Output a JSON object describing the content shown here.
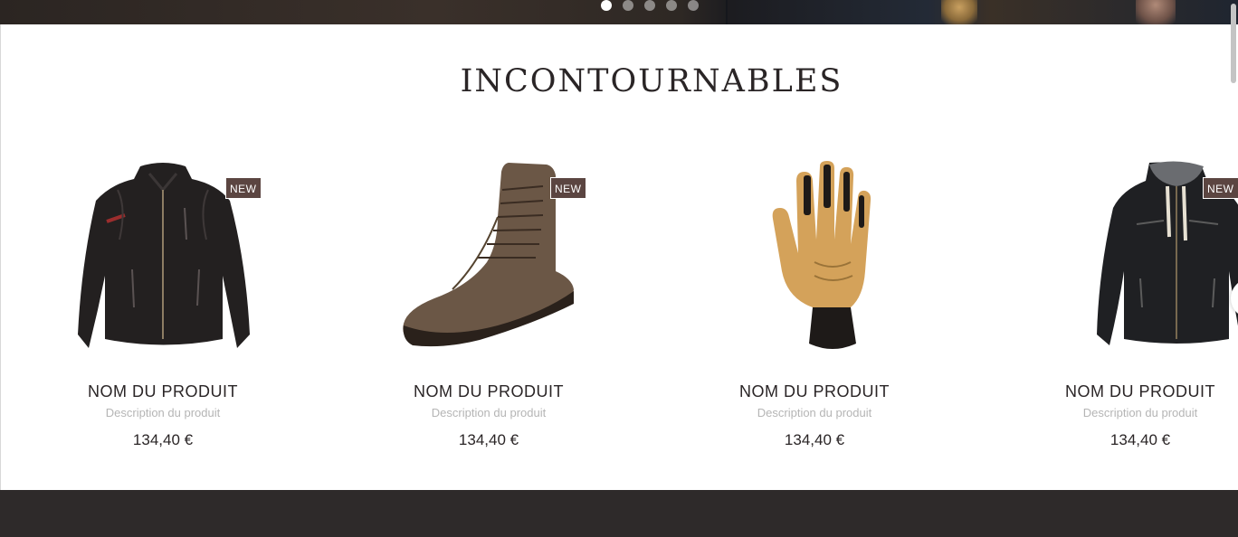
{
  "carousel": {
    "slide_count": 5,
    "active_index": 0
  },
  "section": {
    "title": "INCONTOURNABLES"
  },
  "products": [
    {
      "name": "NOM DU PRODUIT",
      "description": "Description du produit",
      "price": "134,40 €",
      "badge": "NEW",
      "image": "leather-jacket-icon"
    },
    {
      "name": "NOM DU PRODUIT",
      "description": "Description du produit",
      "price": "134,40 €",
      "badge": "NEW",
      "image": "leather-boot-icon"
    },
    {
      "name": "NOM DU PRODUIT",
      "description": "Description du produit",
      "price": "134,40 €",
      "badge": "",
      "image": "motorcycle-glove-icon"
    },
    {
      "name": "NOM DU PRODUIT",
      "description": "Description du produit",
      "price": "134,40 €",
      "badge": "NEW",
      "image": "hooded-jacket-icon"
    }
  ],
  "colors": {
    "badge": "#5b4541",
    "title": "#2a2526",
    "description": "#b5b5b5",
    "footer": "#2e2a2a"
  }
}
